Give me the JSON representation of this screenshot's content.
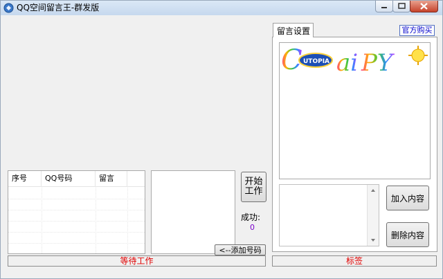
{
  "window": {
    "title": "QQ空间留言王-群发版"
  },
  "controls": {
    "minimize": "minimize",
    "maximize": "maximize",
    "close": "close"
  },
  "list": {
    "columns": [
      "序号",
      "QQ号码",
      "留言"
    ],
    "rows": []
  },
  "buttons": {
    "start": "开始\n工作",
    "add_numbers": "<--添加号码",
    "add_content": "加入内容",
    "delete_content": "删除内容"
  },
  "success": {
    "label": "成功:",
    "count": "0"
  },
  "status": {
    "left": "等待工作",
    "right": "标签"
  },
  "tabs": {
    "active": "留言设置"
  },
  "link": {
    "buy": "官方购买"
  },
  "logo": {
    "text": "CUTOPIA aiPY"
  },
  "colors": {
    "status_text": "#e00000",
    "link": "#0000cc",
    "count": "#7a00cc"
  }
}
